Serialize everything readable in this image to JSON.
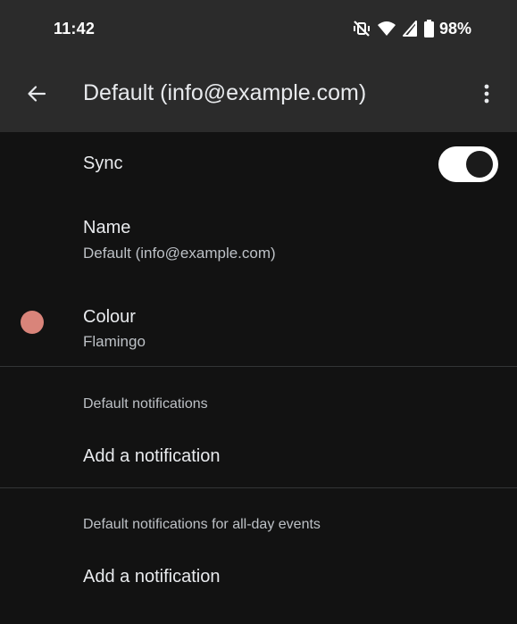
{
  "status_bar": {
    "time": "11:42",
    "battery_percent": "98%",
    "icons": [
      "vibrate-off-icon",
      "wifi-icon",
      "signal-icon",
      "battery-icon"
    ]
  },
  "app_bar": {
    "title": "Default (info@example.com)",
    "back_icon": "arrow-back-icon",
    "menu_icon": "more-vert-icon"
  },
  "settings": {
    "sync": {
      "label": "Sync",
      "enabled": true
    },
    "name": {
      "label": "Name",
      "value": "Default (info@example.com)"
    },
    "colour": {
      "label": "Colour",
      "value": "Flamingo",
      "swatch": "#d9847a"
    },
    "default_notifications": {
      "heading": "Default notifications",
      "add_label": "Add a notification"
    },
    "all_day_notifications": {
      "heading": "Default notifications for all-day events",
      "add_label": "Add a notification"
    }
  },
  "colors": {
    "background": "#121212",
    "app_bar": "#2b2b2b",
    "toggle_track_on": "#ffffff",
    "toggle_knob": "#1b1b1b"
  }
}
